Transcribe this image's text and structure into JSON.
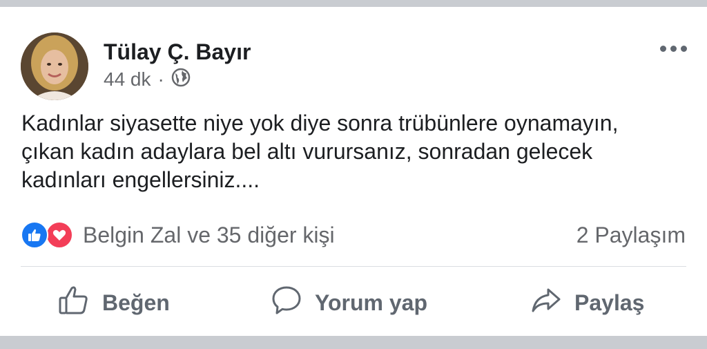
{
  "post": {
    "author": "Tülay Ç. Bayır",
    "time": "44 dk",
    "separator": "·",
    "privacy_icon": "globe-icon",
    "text_lines": [
      "Kadınlar siyasette niye yok diye sonra trübünlere oynamayın,",
      "çıkan kadın adaylara bel altı vurursanız, sonradan gelecek",
      "kadınları engellersiniz...."
    ],
    "reactions": {
      "icons": [
        "like-icon",
        "love-icon"
      ],
      "summary": "Belgin Zal ve 35 diğer kişi"
    },
    "shares": "2 Paylaşım"
  },
  "actions": {
    "like": "Beğen",
    "comment": "Yorum yap",
    "share": "Paylaş"
  },
  "colors": {
    "background": "#c9ccd1",
    "card": "#ffffff",
    "text_primary": "#1c1e21",
    "text_secondary": "#65676b",
    "like_blue": "#1877f2",
    "love_red": "#f33e58"
  }
}
